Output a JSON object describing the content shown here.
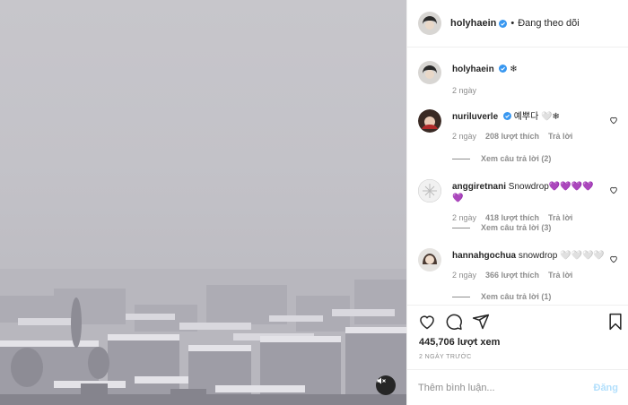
{
  "post": {
    "username": "holyhaein",
    "follow_status": "Đang theo dõi",
    "caption": "❄",
    "caption_time": "2 ngày"
  },
  "comments": [
    {
      "username": "nuriluverle",
      "verified": true,
      "text": "예뿌다 🤍❄",
      "time": "2 ngày",
      "likes": "208 lượt thích",
      "reply_label": "Trả lời",
      "view_replies": "Xem câu trả lời (2)"
    },
    {
      "username": "anggiretnani",
      "verified": false,
      "text": "Snowdrop💜💜💜💜💜",
      "time": "2 ngày",
      "likes": "418 lượt thích",
      "reply_label": "Trả lời",
      "view_replies": "Xem câu trả lời (3)"
    },
    {
      "username": "hannahgochua",
      "verified": false,
      "text": "snowdrop 🤍🤍🤍🤍",
      "time": "2 ngày",
      "likes": "366 lượt thích",
      "reply_label": "Trả lời",
      "view_replies": "Xem câu trả lời (1)"
    }
  ],
  "stats": {
    "views": "445,706 lượt xem",
    "timestamp": "2 NGÀY TRƯỚC"
  },
  "comment_input": {
    "placeholder": "Thêm bình luận...",
    "post_label": "Đăng"
  },
  "icons": {
    "heart": "heart-icon",
    "comment": "comment-icon",
    "share": "share-icon",
    "save": "bookmark-icon",
    "mute": "mute-icon",
    "verified": "verified-badge-icon"
  },
  "colors": {
    "verified": "#3897f0",
    "post_button_disabled": "#b2dffc",
    "muted_text": "#8e8e8e"
  }
}
